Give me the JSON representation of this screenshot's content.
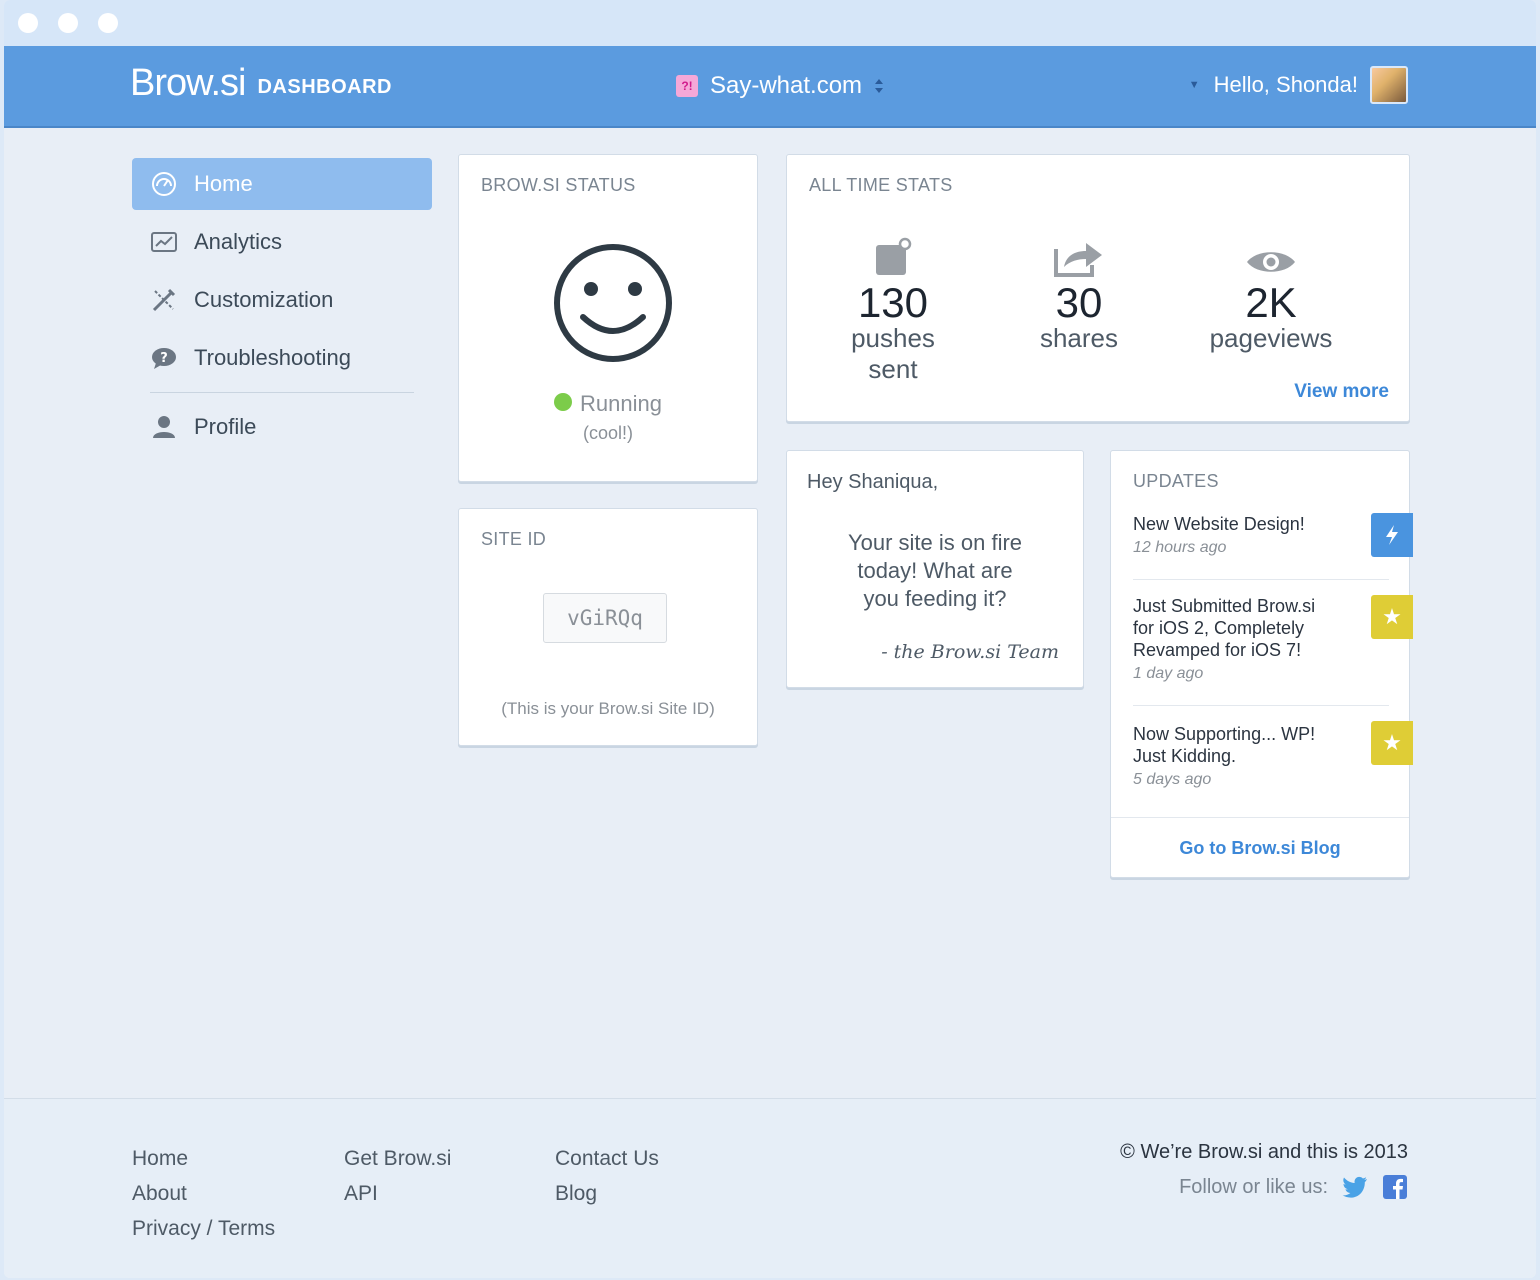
{
  "header": {
    "brand_logo": "Brow.si",
    "brand_section": "DASHBOARD",
    "site_name": "Say-what.com",
    "greeting": "Hello, Shonda!"
  },
  "sidebar": {
    "items": [
      {
        "label": "Home",
        "icon": "dashboard-icon",
        "active": true
      },
      {
        "label": "Analytics",
        "icon": "analytics-icon"
      },
      {
        "label": "Customization",
        "icon": "customization-icon"
      },
      {
        "label": "Troubleshooting",
        "icon": "help-icon"
      },
      {
        "label": "Profile",
        "icon": "user-icon"
      }
    ]
  },
  "status": {
    "title": "BROW.SI STATUS",
    "state": "Running",
    "note": "(cool!)",
    "state_color": "#7ccc4a"
  },
  "site_id": {
    "title": "SITE ID",
    "value": "vGiRQq",
    "note": "(This is your Brow.si Site ID)"
  },
  "stats": {
    "title": "ALL TIME STATS",
    "items": [
      {
        "value": "130",
        "label": "pushes sent",
        "icon": "push-icon"
      },
      {
        "value": "30",
        "label": "shares",
        "icon": "share-icon"
      },
      {
        "value": "2K",
        "label": "pageviews",
        "icon": "eye-icon"
      }
    ],
    "view_more": "View more"
  },
  "message": {
    "greeting": "Hey Shaniqua,",
    "line1": "Your site is on fire",
    "line2": "today! What are",
    "line3": "you feeding it?",
    "signature": "- the Brow.si Team"
  },
  "updates": {
    "title": "UPDATES",
    "items": [
      {
        "line1": "New Website Design!",
        "line2": "",
        "line3": "",
        "time": "12 hours ago",
        "badge": "lightning-icon",
        "badge_color": "#4a94df"
      },
      {
        "line1": "Just Submitted Brow.si",
        "line2": "for iOS 2, Completely",
        "line3": "Revamped for iOS 7!",
        "time": "1 day ago",
        "badge": "star-icon",
        "badge_color": "#dfcd36"
      },
      {
        "line1": "Now Supporting... WP!",
        "line2": "Just Kidding.",
        "line3": "",
        "time": "5 days ago",
        "badge": "star-icon",
        "badge_color": "#dfcd36"
      }
    ],
    "blog_link": "Go to Brow.si Blog"
  },
  "footer": {
    "col1": [
      "Home",
      "About",
      "Privacy / Terms"
    ],
    "col2": [
      "Get Brow.si",
      "API"
    ],
    "col3": [
      "Contact Us",
      "Blog"
    ],
    "copyright": "© We’re Brow.si and this is 2013",
    "follow": "Follow or like us:",
    "social": [
      "twitter-icon",
      "facebook-icon"
    ]
  },
  "colors": {
    "header_bg": "#5b9bdf",
    "accent": "#3d88d8",
    "active_nav": "#8fbcee"
  }
}
